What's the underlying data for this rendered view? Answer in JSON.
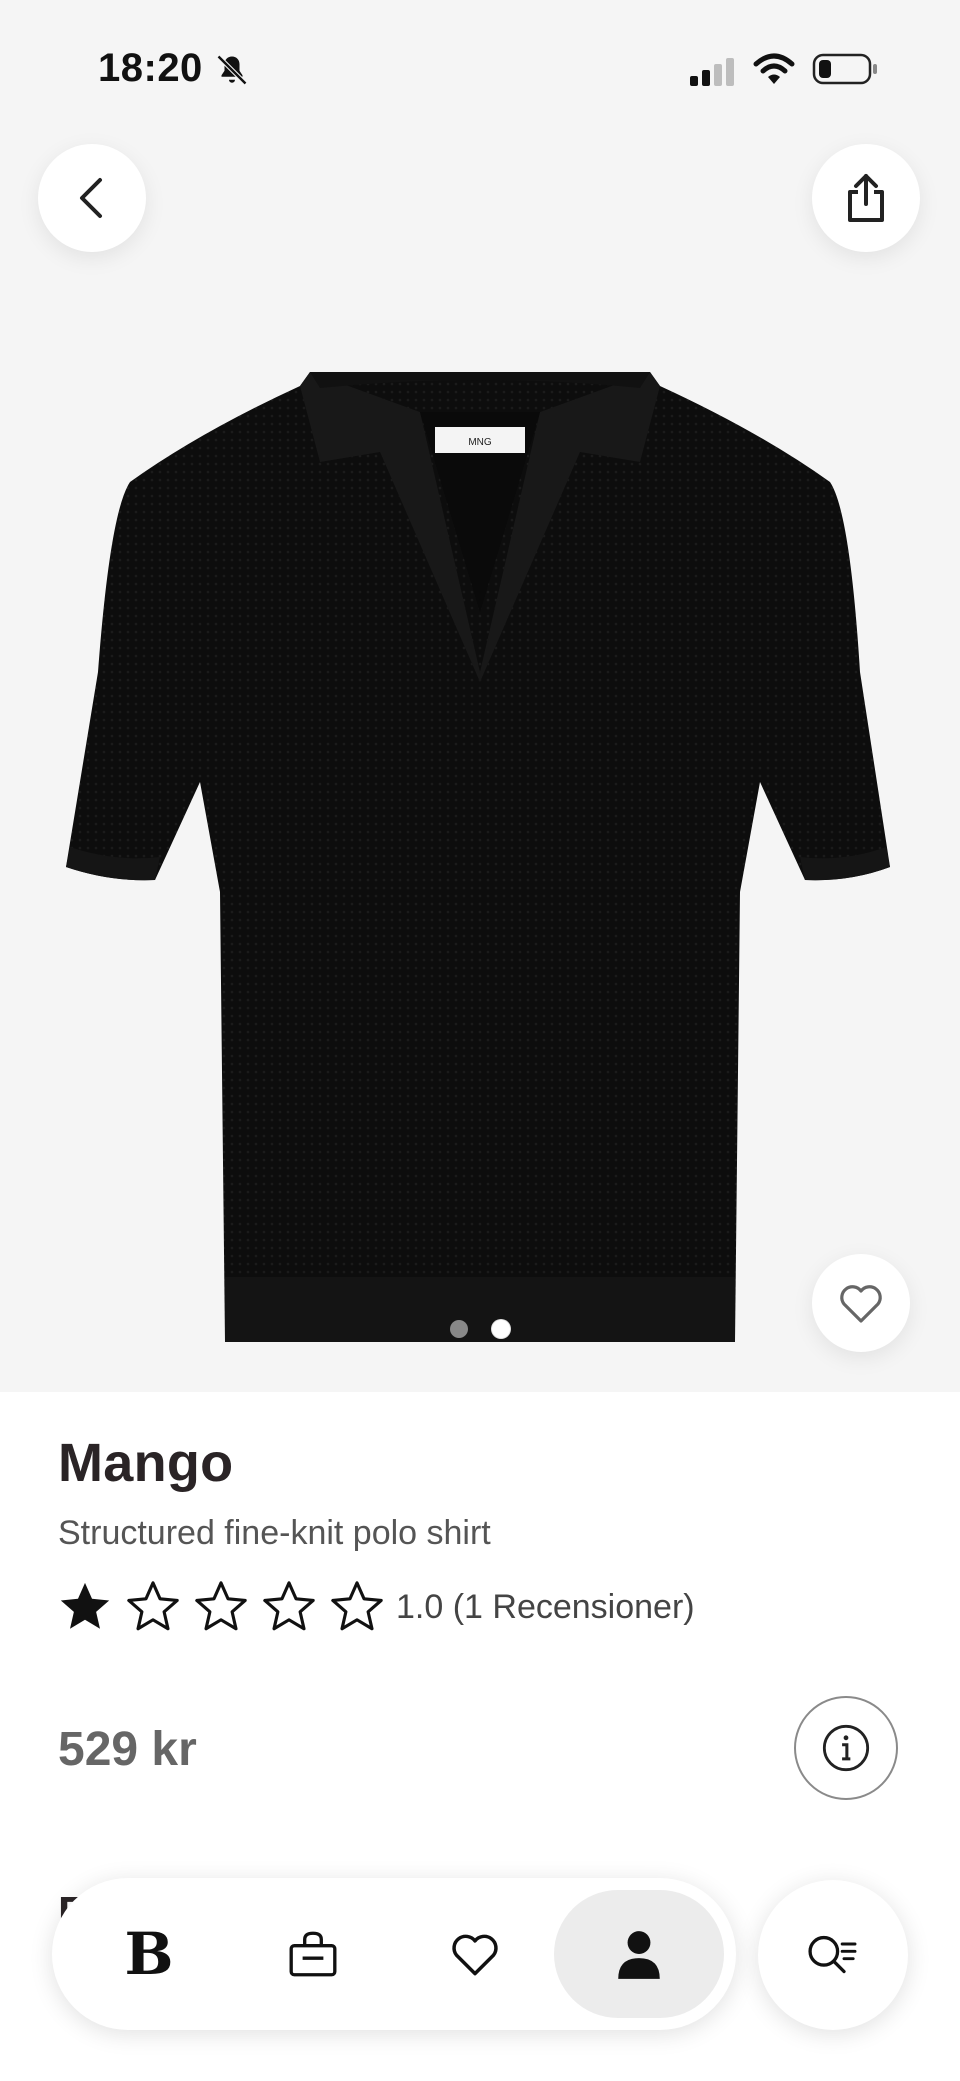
{
  "status_bar": {
    "time": "18:20"
  },
  "product": {
    "brand": "Mango",
    "name": "Structured fine-knit polo shirt",
    "rating": 1.0,
    "rating_text": "1.0 (1 Recensioner)",
    "price": "529 kr",
    "image_pages": 2,
    "active_image": 2
  },
  "nav": {
    "logo_label": "B",
    "items": [
      "logo",
      "bag-icon",
      "heart-icon",
      "profile-icon"
    ],
    "selected": "profile-icon"
  },
  "peek": {
    "text": "F"
  }
}
